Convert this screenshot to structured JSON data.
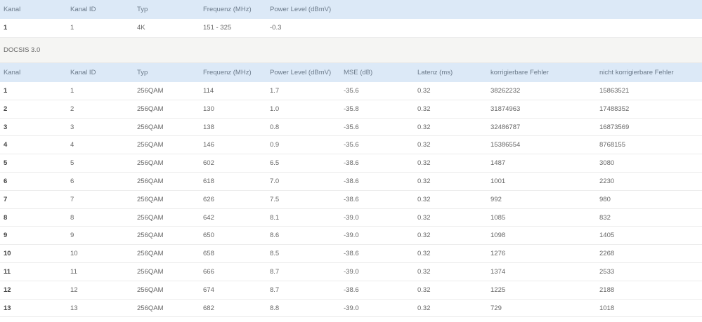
{
  "ofdm_table": {
    "headers": [
      "Kanal",
      "Kanal ID",
      "Typ",
      "Frequenz (MHz)",
      "Power Level (dBmV)"
    ],
    "rows": [
      [
        "1",
        "1",
        "4K",
        "151 - 325",
        "-0.3"
      ]
    ]
  },
  "docsis_section": {
    "title": "DOCSIS 3.0"
  },
  "docsis_table": {
    "headers": [
      "Kanal",
      "Kanal ID",
      "Typ",
      "Frequenz (MHz)",
      "Power Level (dBmV)",
      "MSE (dB)",
      "Latenz (ms)",
      "korrigierbare Fehler",
      "nicht korrigierbare Fehler"
    ],
    "rows": [
      [
        "1",
        "1",
        "256QAM",
        "114",
        "1.7",
        "-35.6",
        "0.32",
        "38262232",
        "15863521"
      ],
      [
        "2",
        "2",
        "256QAM",
        "130",
        "1.0",
        "-35.8",
        "0.32",
        "31874963",
        "17488352"
      ],
      [
        "3",
        "3",
        "256QAM",
        "138",
        "0.8",
        "-35.6",
        "0.32",
        "32486787",
        "16873569"
      ],
      [
        "4",
        "4",
        "256QAM",
        "146",
        "0.9",
        "-35.6",
        "0.32",
        "15386554",
        "8768155"
      ],
      [
        "5",
        "5",
        "256QAM",
        "602",
        "6.5",
        "-38.6",
        "0.32",
        "1487",
        "3080"
      ],
      [
        "6",
        "6",
        "256QAM",
        "618",
        "7.0",
        "-38.6",
        "0.32",
        "1001",
        "2230"
      ],
      [
        "7",
        "7",
        "256QAM",
        "626",
        "7.5",
        "-38.6",
        "0.32",
        "992",
        "980"
      ],
      [
        "8",
        "8",
        "256QAM",
        "642",
        "8.1",
        "-39.0",
        "0.32",
        "1085",
        "832"
      ],
      [
        "9",
        "9",
        "256QAM",
        "650",
        "8.6",
        "-39.0",
        "0.32",
        "1098",
        "1405"
      ],
      [
        "10",
        "10",
        "256QAM",
        "658",
        "8.5",
        "-38.6",
        "0.32",
        "1276",
        "2268"
      ],
      [
        "11",
        "11",
        "256QAM",
        "666",
        "8.7",
        "-39.0",
        "0.32",
        "1374",
        "2533"
      ],
      [
        "12",
        "12",
        "256QAM",
        "674",
        "8.7",
        "-38.6",
        "0.32",
        "1225",
        "2188"
      ],
      [
        "13",
        "13",
        "256QAM",
        "682",
        "8.8",
        "-39.0",
        "0.32",
        "729",
        "1018"
      ]
    ]
  }
}
